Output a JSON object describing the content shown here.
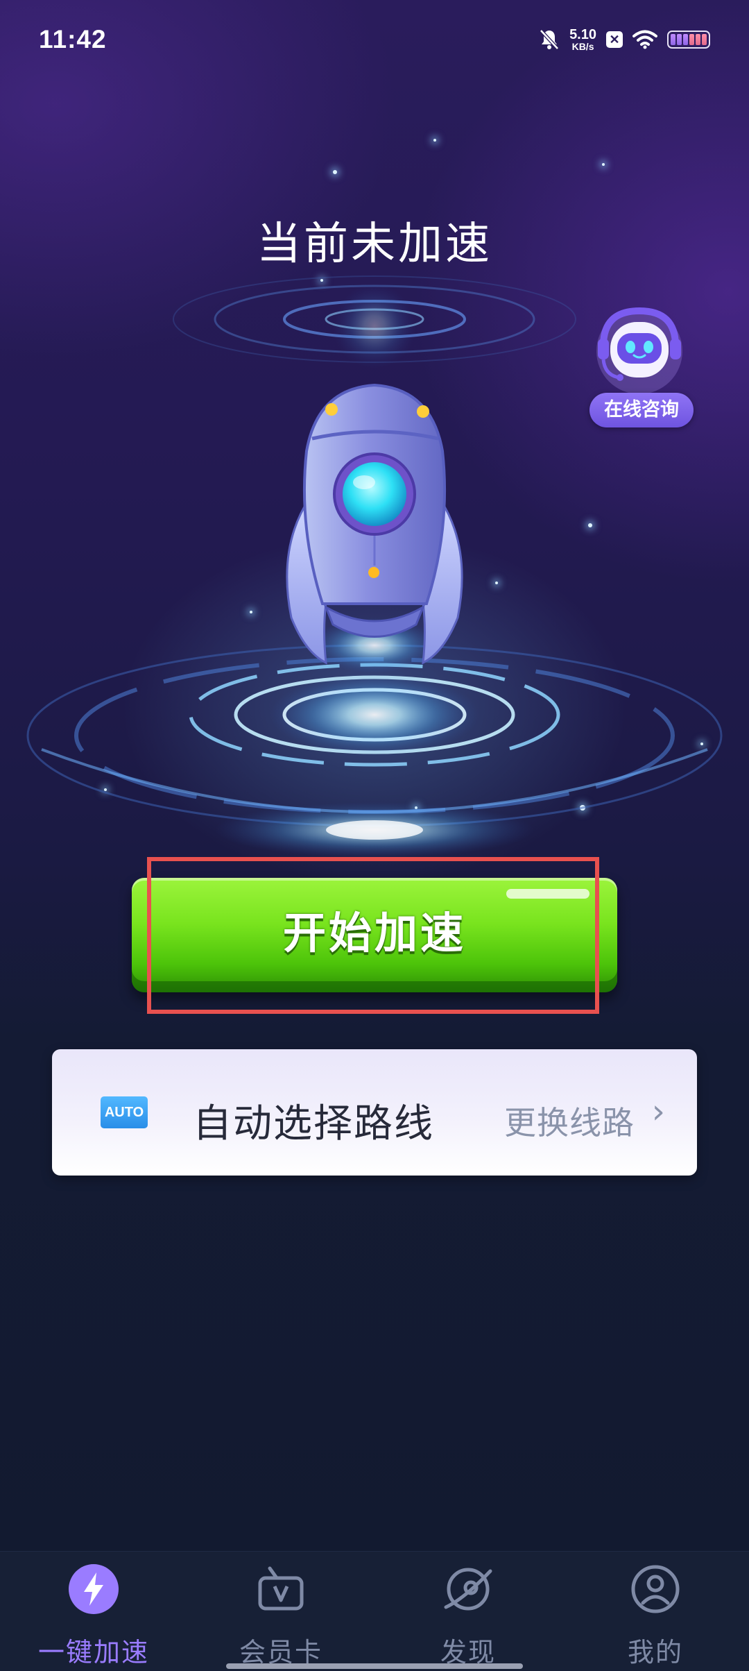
{
  "status_bar": {
    "time": "11:42",
    "speed_value": "5.10",
    "speed_unit": "KB/s",
    "icons": [
      "bell-muted-icon",
      "x-box-icon",
      "wifi-icon",
      "battery-icon"
    ]
  },
  "header": {
    "title": "当前未加速"
  },
  "assistant": {
    "label": "在线咨询",
    "icon": "robot-headset-icon"
  },
  "start_button": {
    "label": "开始加速"
  },
  "route": {
    "badge": "AUTO",
    "label": "自动选择路线",
    "action": "更换线路",
    "chevron": "›"
  },
  "bottom_nav": {
    "items": [
      {
        "label": "一键加速",
        "icon": "lightning-icon",
        "active": true
      },
      {
        "label": "会员卡",
        "icon": "vip-card-icon",
        "active": false
      },
      {
        "label": "发现",
        "icon": "discover-planet-icon",
        "active": false
      },
      {
        "label": "我的",
        "icon": "profile-icon",
        "active": false
      }
    ]
  },
  "colors": {
    "accent": "#9a7cff",
    "start_green": "#6ad516",
    "highlight_red": "#e8514f"
  }
}
